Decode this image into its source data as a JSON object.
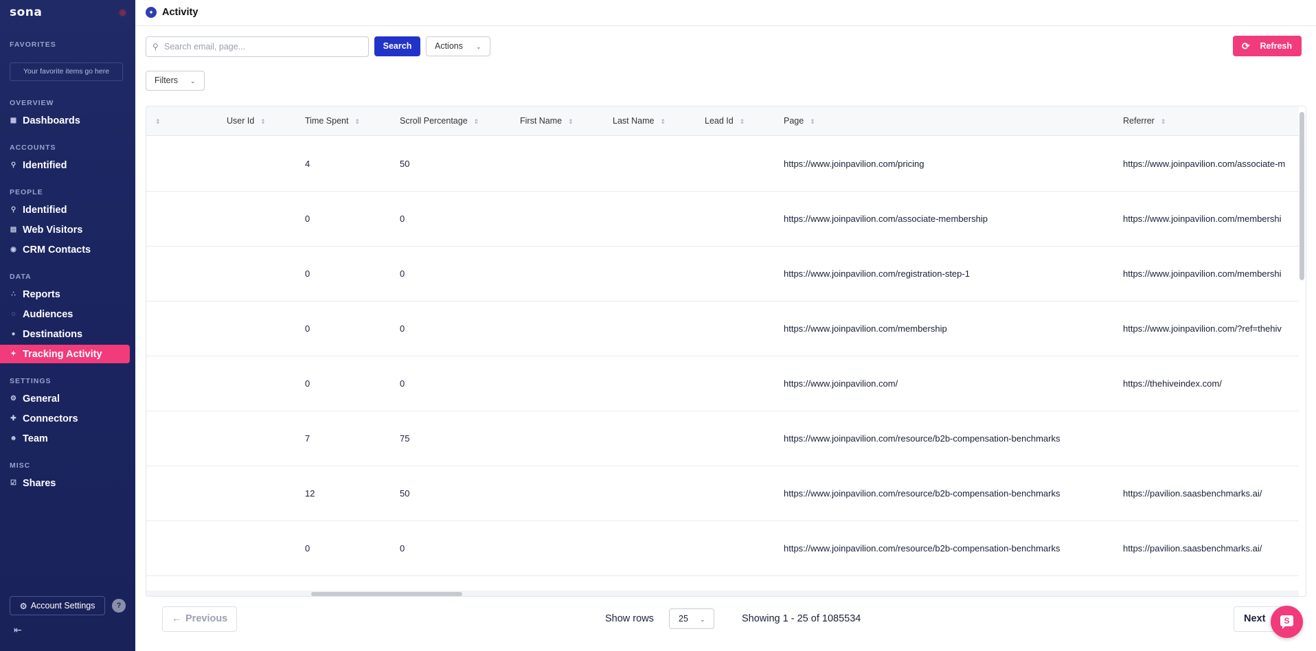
{
  "sidebar": {
    "logo": "sona",
    "favorites_label": "FAVORITES",
    "favorites_placeholder": "Your favorite items go here",
    "sections": [
      {
        "label": "OVERVIEW",
        "items": [
          {
            "label": "Dashboards",
            "icon": "bar-chart-icon"
          }
        ]
      },
      {
        "label": "ACCOUNTS",
        "items": [
          {
            "label": "Identified",
            "icon": "search-person-icon"
          }
        ]
      },
      {
        "label": "PEOPLE",
        "items": [
          {
            "label": "Identified",
            "icon": "search-person-icon"
          },
          {
            "label": "Web Visitors",
            "icon": "browser-icon"
          },
          {
            "label": "CRM Contacts",
            "icon": "people-icon"
          }
        ]
      },
      {
        "label": "DATA",
        "items": [
          {
            "label": "Reports",
            "icon": "scatter-icon"
          },
          {
            "label": "Audiences",
            "icon": "audience-icon"
          },
          {
            "label": "Destinations",
            "icon": "location-pin-icon"
          },
          {
            "label": "Tracking Activity",
            "icon": "compass-icon",
            "active": true
          }
        ]
      },
      {
        "label": "SETTINGS",
        "items": [
          {
            "label": "General",
            "icon": "gear-icon"
          },
          {
            "label": "Connectors",
            "icon": "puzzle-icon"
          },
          {
            "label": "Team",
            "icon": "person-icon"
          }
        ]
      },
      {
        "label": "MISC",
        "items": [
          {
            "label": "Shares",
            "icon": "share-icon"
          }
        ]
      }
    ],
    "account_settings": "Account Settings",
    "help": "?"
  },
  "header": {
    "title": "Activity",
    "icon": "compass-icon"
  },
  "toolbar": {
    "search_placeholder": "Search email, page...",
    "search_button": "Search",
    "actions_button": "Actions",
    "refresh_button": "Refresh",
    "filters_button": "Filters"
  },
  "table": {
    "columns": [
      "",
      "User Id",
      "Time Spent",
      "Scroll Percentage",
      "First Name",
      "Last Name",
      "Lead Id",
      "Page",
      "Referrer"
    ],
    "rows": [
      {
        "time_spent": "4",
        "scroll": "50",
        "page": "https://www.joinpavilion.com/pricing",
        "referrer": "https://www.joinpavilion.com/associate-m"
      },
      {
        "time_spent": "0",
        "scroll": "0",
        "page": "https://www.joinpavilion.com/associate-membership",
        "referrer": "https://www.joinpavilion.com/membershi"
      },
      {
        "time_spent": "0",
        "scroll": "0",
        "page": "https://www.joinpavilion.com/registration-step-1",
        "referrer": "https://www.joinpavilion.com/membershi"
      },
      {
        "time_spent": "0",
        "scroll": "0",
        "page": "https://www.joinpavilion.com/membership",
        "referrer": "https://www.joinpavilion.com/?ref=thehiv"
      },
      {
        "time_spent": "0",
        "scroll": "0",
        "page": "https://www.joinpavilion.com/",
        "referrer": "https://thehiveindex.com/"
      },
      {
        "time_spent": "7",
        "scroll": "75",
        "page": "https://www.joinpavilion.com/resource/b2b-compensation-benchmarks",
        "referrer": ""
      },
      {
        "time_spent": "12",
        "scroll": "50",
        "page": "https://www.joinpavilion.com/resource/b2b-compensation-benchmarks",
        "referrer": "https://pavilion.saasbenchmarks.ai/"
      },
      {
        "time_spent": "0",
        "scroll": "0",
        "page": "https://www.joinpavilion.com/resource/b2b-compensation-benchmarks",
        "referrer": "https://pavilion.saasbenchmarks.ai/"
      }
    ]
  },
  "footer": {
    "previous": "Previous",
    "show_rows_label": "Show rows",
    "rows_value": "25",
    "showing_text": "Showing 1 - 25 of 1085534",
    "next": "Next"
  },
  "colors": {
    "sidebar": "#1f2a66",
    "accent_pink": "#f23b7a",
    "primary_blue": "#2233c9"
  }
}
